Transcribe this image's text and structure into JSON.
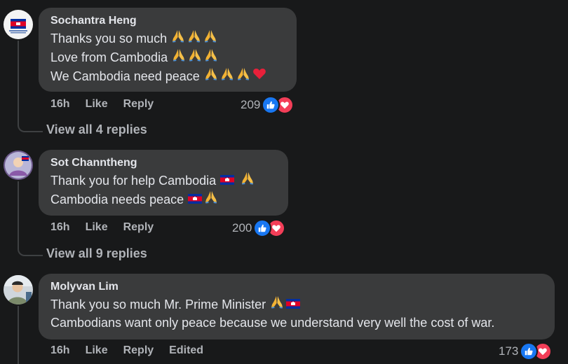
{
  "comments": [
    {
      "author": "Sochantra Heng",
      "lines": [
        "Thanks you so much",
        "Love from Cambodia",
        "We Cambodia need peace"
      ],
      "time": "16h",
      "like": "Like",
      "reply": "Reply",
      "reaction_count": "209",
      "view_replies": "View all 4 replies"
    },
    {
      "author": "Sot Channtheng",
      "lines": [
        "Thank you for help Cambodia",
        "Cambodia needs peace"
      ],
      "time": "16h",
      "like": "Like",
      "reply": "Reply",
      "reaction_count": "200",
      "view_replies": "View all 9 replies"
    },
    {
      "author": "Molyvan Lim",
      "lines": [
        "Thank you so much Mr. Prime Minister",
        "Cambodians want only peace because we understand very well the cost of war."
      ],
      "time": "16h",
      "like": "Like",
      "reply": "Reply",
      "edited": "Edited",
      "reaction_count": "173"
    }
  ],
  "colors": {
    "background": "#18191a",
    "bubble": "#3a3b3c",
    "text": "#e4e6eb",
    "secondary": "#b0b3b8",
    "like_blue": "#1877f2",
    "love_red": "#f33e58"
  },
  "icons": [
    "praying-hands-emoji",
    "red-heart-emoji",
    "cambodia-flag-emoji",
    "like-reaction-icon",
    "love-reaction-icon"
  ]
}
